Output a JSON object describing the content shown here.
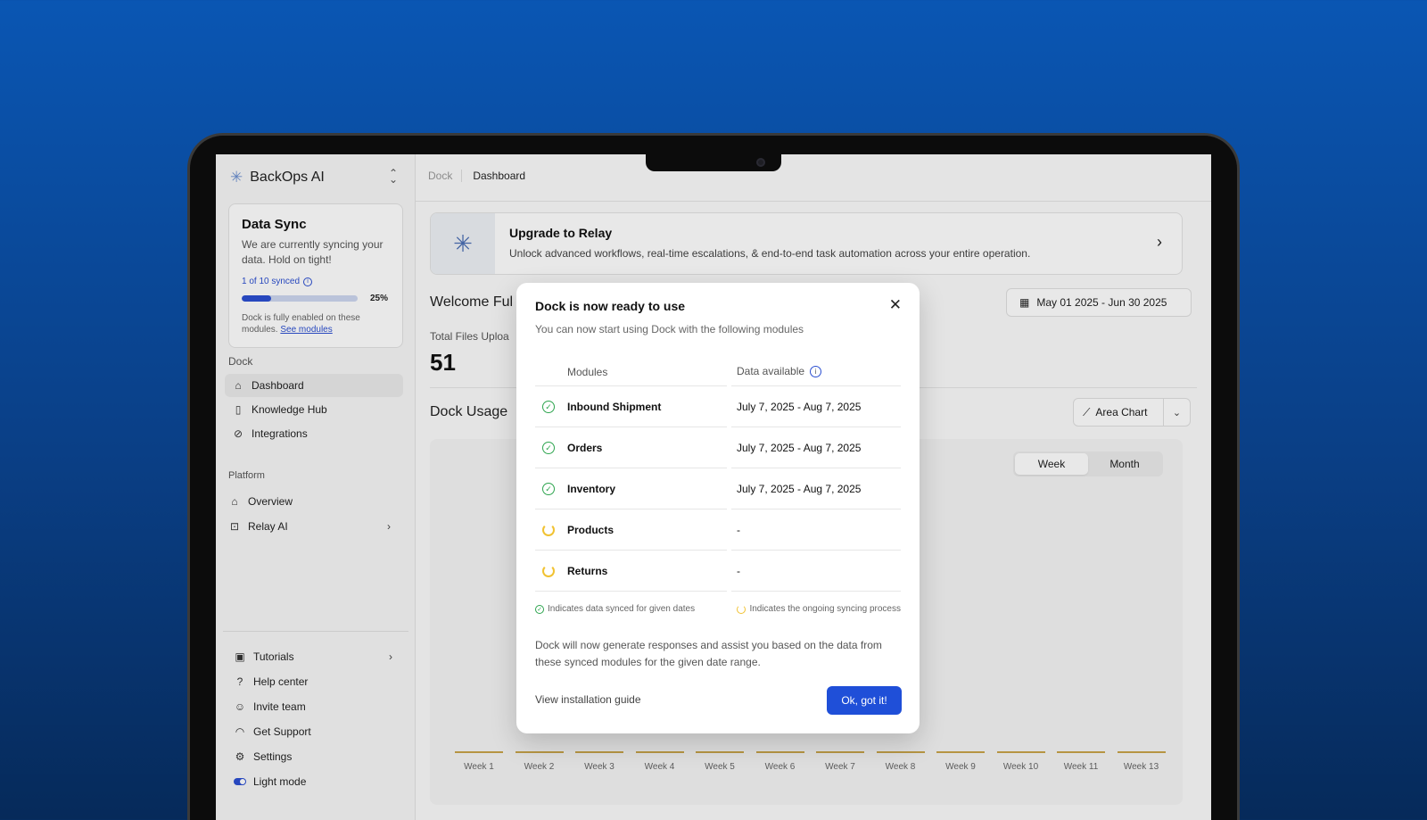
{
  "sidebar": {
    "brand": "BackOps AI",
    "sync_card": {
      "title": "Data Sync",
      "description": "We are currently syncing your data. Hold on tight!",
      "synced_count": "1 of 10 synced",
      "progress_pct": "25%",
      "progress_fraction": 0.25,
      "note": "Dock is fully enabled on these modules.",
      "note_link": "See modules"
    },
    "dock_section": "Dock",
    "dock_items": [
      {
        "label": "Dashboard",
        "icon": "home-icon"
      },
      {
        "label": "Knowledge Hub",
        "icon": "book-icon"
      },
      {
        "label": "Integrations",
        "icon": "link-icon"
      }
    ],
    "platform_section": "Platform",
    "platform_items": [
      {
        "label": "Overview",
        "icon": "home-icon"
      },
      {
        "label": "Relay AI",
        "icon": "bot-icon"
      }
    ],
    "bottom_items": [
      {
        "label": "Tutorials",
        "icon": "tutorial-icon"
      },
      {
        "label": "Help center",
        "icon": "help-icon"
      },
      {
        "label": "Invite team",
        "icon": "users-icon"
      },
      {
        "label": "Get Support",
        "icon": "headset-icon"
      },
      {
        "label": "Settings",
        "icon": "gear-icon"
      },
      {
        "label": "Light mode",
        "icon": "toggle-icon"
      }
    ]
  },
  "header": {
    "breadcrumb_parent": "Dock",
    "breadcrumb_current": "Dashboard"
  },
  "upgrade": {
    "title": "Upgrade to Relay",
    "description": "Unlock advanced workflows, real-time escalations, & end-to-end task automation across your entire operation."
  },
  "dashboard": {
    "welcome": "Welcome Ful",
    "date_range": "May 01 2025 - Jun 30 2025",
    "files_label": "Total Files Uploa",
    "files_value": "51",
    "usage_title": "Dock Usage",
    "chart_type_label": "Area Chart",
    "period_week": "Week",
    "period_month": "Month",
    "weeks": [
      "Week 1",
      "Week 2",
      "Week 3",
      "Week 4",
      "Week 5",
      "Week 6",
      "Week 7",
      "Week 8",
      "Week 9",
      "Week 10",
      "Week 11",
      "Week 13"
    ]
  },
  "modal": {
    "title": "Dock is now ready to use",
    "subtitle": "You can now start using Dock with the following modules",
    "col_modules": "Modules",
    "col_data": "Data available",
    "rows": [
      {
        "module": "Inbound Shipment",
        "data": "July 7, 2025 - Aug 7, 2025",
        "status": "synced"
      },
      {
        "module": "Orders",
        "data": "July 7, 2025 - Aug 7, 2025",
        "status": "synced"
      },
      {
        "module": "Inventory",
        "data": "July 7, 2025 - Aug 7, 2025",
        "status": "synced"
      },
      {
        "module": "Products",
        "data": "-",
        "status": "syncing"
      },
      {
        "module": "Returns",
        "data": "-",
        "status": "syncing"
      }
    ],
    "legend_synced": "Indicates data synced for given dates",
    "legend_syncing": "Indicates the ongoing syncing process",
    "note": "Dock will now generate responses and assist you based on the data from these synced modules for the given date range.",
    "guide_link": "View installation guide",
    "ok_button": "Ok, got it!"
  },
  "colors": {
    "accent": "#1f4fd8",
    "synced": "#2da44e",
    "syncing": "#f1c232",
    "background_top": "#0a56b3"
  }
}
